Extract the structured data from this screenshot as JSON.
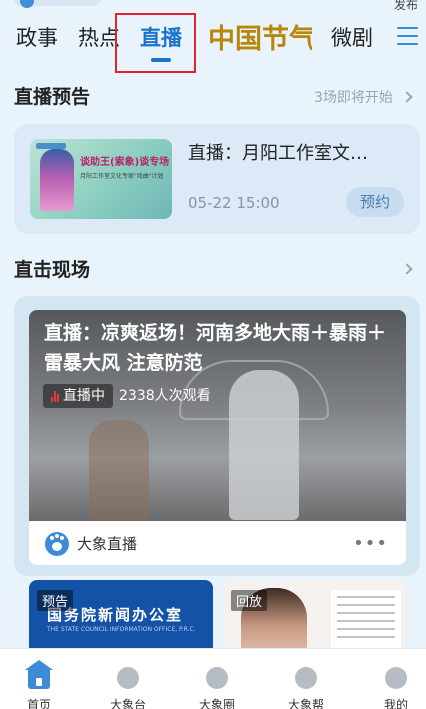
{
  "header": {
    "publish_label": "发布",
    "tabs": [
      {
        "label": "政事"
      },
      {
        "label": "热点"
      },
      {
        "label": "直播",
        "active": true
      },
      {
        "label": "中国节气",
        "style": "calligraphy-logo"
      },
      {
        "label": "微剧"
      }
    ],
    "menu_icon": "hamburger-menu-icon"
  },
  "preview_section": {
    "title": "直播预告",
    "more_text": "3场即将开始",
    "item": {
      "thumb_title": "谈助王(索象)谈专场",
      "thumb_subtitle": "月阳工作室文化专家\"戏曲\"计划",
      "title": "直播：月阳工作室文…",
      "time": "05-22  15:00",
      "action": "预约"
    }
  },
  "live_section": {
    "title": "直击现场",
    "card": {
      "title": "直播：凉爽返场！河南多地大雨＋暴雨＋雷暴大风 注意防范",
      "status": "直播中",
      "views": "2338人次观看",
      "source": "大象直播",
      "more": "•••"
    }
  },
  "mini_cards": [
    {
      "tag": "预告",
      "title": "国务院新闻办公室",
      "subtitle": "THE STATE COUNCIL INFORMATION OFFICE, P.R.C."
    },
    {
      "tag": "回放"
    }
  ],
  "bottom_nav": {
    "items": [
      {
        "label": "首页",
        "icon": "home-icon",
        "active": true
      },
      {
        "label": "大象台",
        "icon": "dx-tv-icon"
      },
      {
        "label": "大象圈",
        "icon": "paw-icon"
      },
      {
        "label": "大象帮",
        "icon": "refresh-help-icon"
      },
      {
        "label": "我的",
        "icon": "profile-icon"
      }
    ]
  },
  "colors": {
    "accent": "#1b74c9",
    "highlight_box": "#e3232c",
    "background": "#e9f3fb"
  }
}
